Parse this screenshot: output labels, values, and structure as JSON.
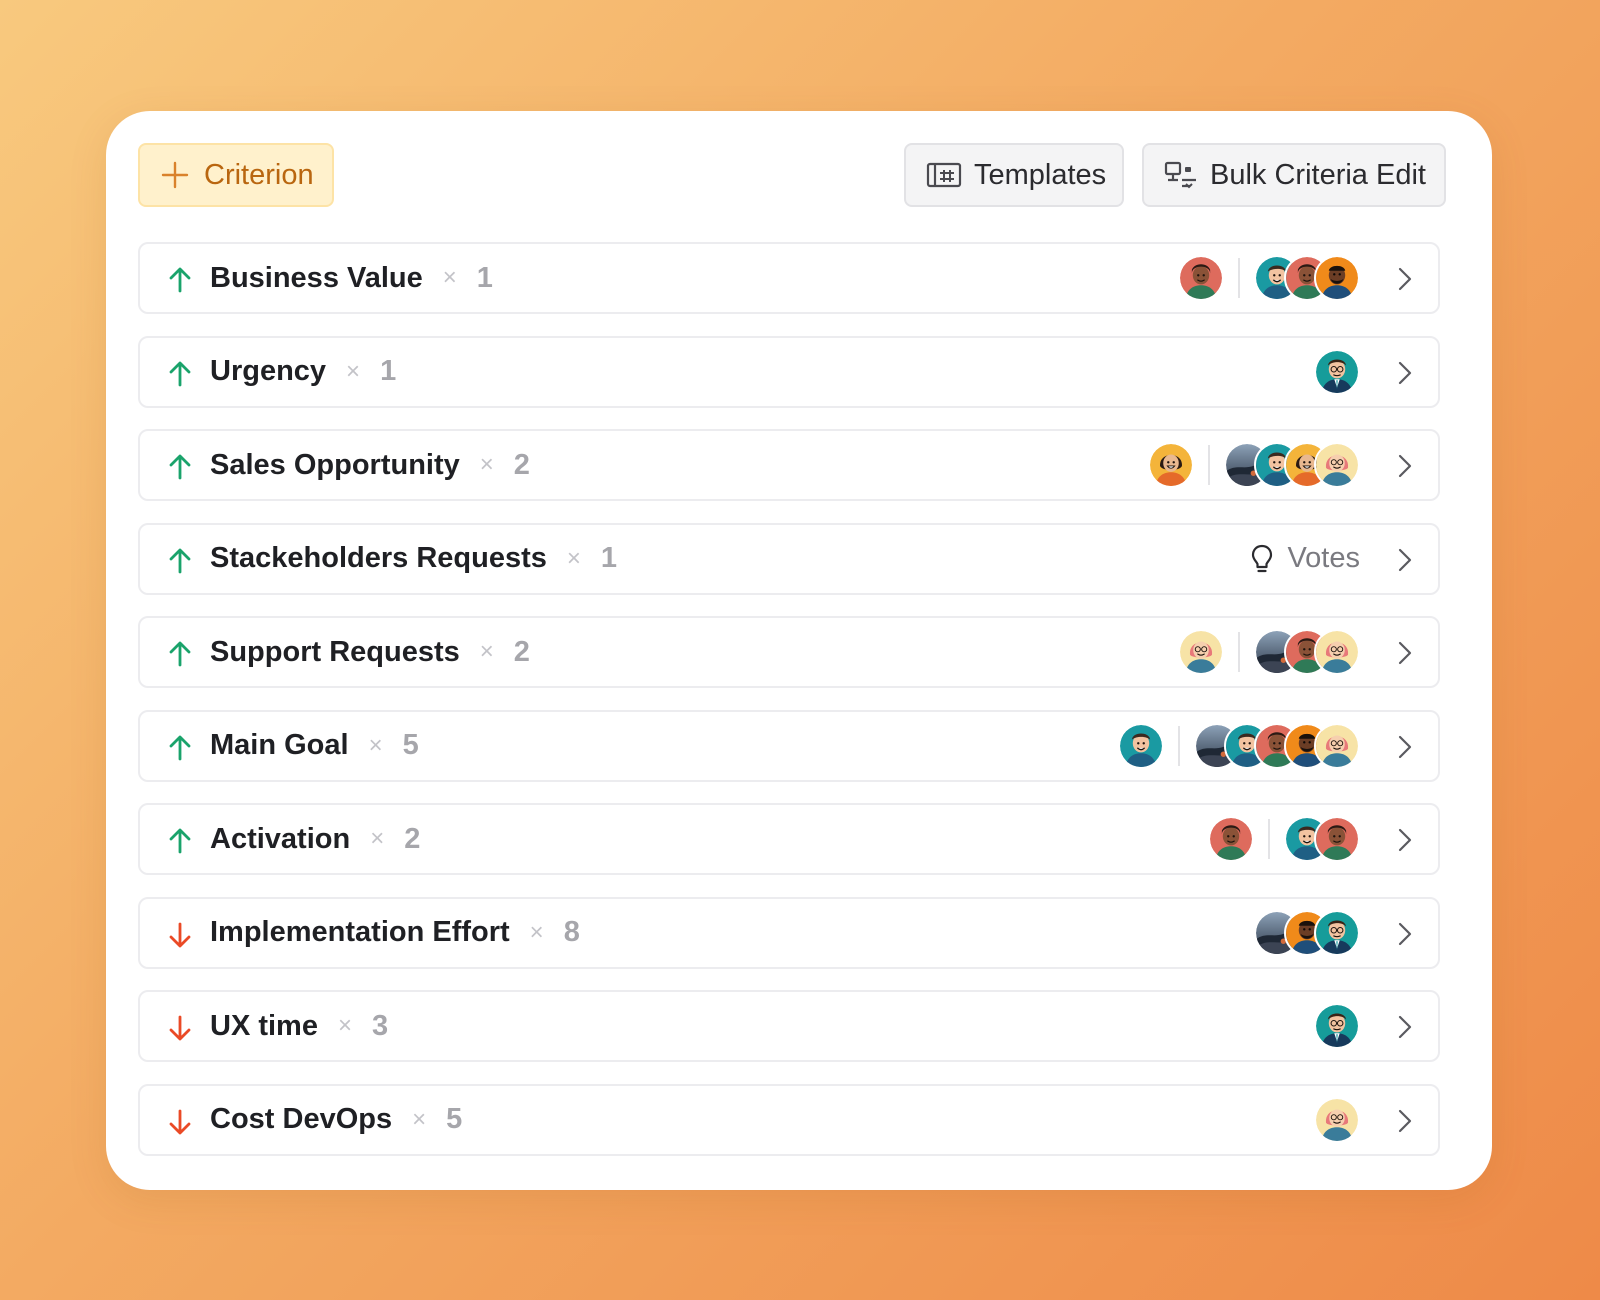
{
  "toolbar": {
    "add_label": "Criterion",
    "templates_label": "Templates",
    "bulk_label": "Bulk Criteria Edit"
  },
  "colors": {
    "up": "#1aa36b",
    "down": "#ea4a26",
    "accent": "#b9660f"
  },
  "criteria": [
    {
      "name": "Business Value",
      "times": "×",
      "weight": "1",
      "direction": "up",
      "owner": [
        "woman-green"
      ],
      "voters": [
        "man-teal",
        "woman-green",
        "man-orange"
      ]
    },
    {
      "name": "Urgency",
      "times": "×",
      "weight": "1",
      "direction": "up",
      "owner": [],
      "voters": [
        "man-suit"
      ]
    },
    {
      "name": "Sales Opportunity",
      "times": "×",
      "weight": "2",
      "direction": "up",
      "owner": [
        "woman-yellow"
      ],
      "voters": [
        "photo",
        "man-teal",
        "woman-yellow",
        "woman-pink"
      ]
    },
    {
      "name": "Stackeholders Requests",
      "times": "×",
      "weight": "1",
      "direction": "up",
      "owner": [],
      "voters": [],
      "votes_label": "Votes"
    },
    {
      "name": "Support Requests",
      "times": "×",
      "weight": "2",
      "direction": "up",
      "owner": [
        "woman-pink"
      ],
      "voters": [
        "photo",
        "woman-green",
        "woman-pink"
      ]
    },
    {
      "name": "Main Goal",
      "times": "×",
      "weight": "5",
      "direction": "up",
      "owner": [
        "man-teal"
      ],
      "voters": [
        "photo",
        "man-teal",
        "woman-green",
        "man-orange",
        "woman-pink"
      ]
    },
    {
      "name": "Activation",
      "times": "×",
      "weight": "2",
      "direction": "up",
      "owner": [
        "woman-green"
      ],
      "voters": [
        "man-teal",
        "woman-green"
      ]
    },
    {
      "name": "Implementation Effort",
      "times": "×",
      "weight": "8",
      "direction": "down",
      "owner": [],
      "voters": [
        "photo",
        "man-orange",
        "man-suit"
      ]
    },
    {
      "name": "UX time",
      "times": "×",
      "weight": "3",
      "direction": "down",
      "owner": [],
      "voters": [
        "man-suit"
      ]
    },
    {
      "name": "Cost DevOps",
      "times": "×",
      "weight": "5",
      "direction": "down",
      "owner": [],
      "voters": [
        "woman-pink"
      ]
    }
  ]
}
